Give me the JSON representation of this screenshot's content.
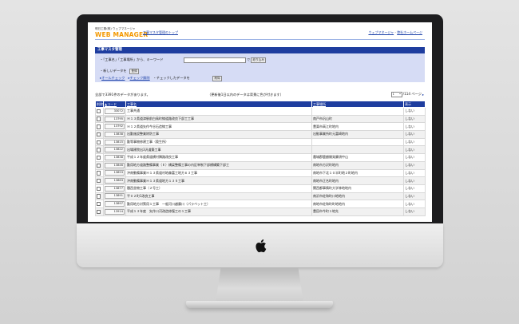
{
  "header": {
    "logo_small": "明日工務(株) ウェブマネージャ",
    "logo_main": "WEB MANAGER",
    "top_link": "工事マスタ管理のトップ",
    "right_links": [
      "ウェブマネージャ",
      "弊社ホームページ"
    ],
    "separator": " - "
  },
  "section": {
    "title": "工事マスタ管理"
  },
  "search": {
    "prefix": "・「工事名」「工事場所」から、キーワード",
    "keyword_value": "",
    "suffix": "で",
    "filter_button": "絞り込み"
  },
  "actions": {
    "new_prefix": "・新しいデータを",
    "new_button": "登録",
    "check_all": "オールチェック",
    "uncheck_all": "チェック解除",
    "checked_prefix": "・チェックしたデータを",
    "delete_button": "削除"
  },
  "summary": "全部で3391件のデータがあります。",
  "note": "（更新後1日以内のデータは背景に色が付きます）",
  "pager": {
    "current_page": "1",
    "total": "/114 ページ",
    "next": "▸"
  },
  "table": {
    "headers": {
      "delete": "削除",
      "code": "▲コード",
      "name": "工事名",
      "place": "工事場所",
      "display": "表示"
    },
    "rows": [
      {
        "code": "33072",
        "name": "工事共通",
        "place": "",
        "display": "しない"
      },
      {
        "code": "13795",
        "name": "Ｈ１３県道津駅前白鳥町線道路改良下部工工事",
        "place": "南戸市汎山町",
        "display": "しない"
      },
      {
        "code": "13792",
        "name": "Ｈ１２県道矢作今谷石造線工事",
        "place": "豊栗市高江町地内",
        "display": "しない"
      },
      {
        "code": "13838",
        "name": "出勤施設整業除防工事",
        "place": "出勧事業所町元富崎地内",
        "display": "しない"
      },
      {
        "code": "13815",
        "name": "勤等事物修建工事（奥生所）",
        "place": "",
        "display": "しない"
      },
      {
        "code": "13822",
        "name": "出場建院出3汎道築工事",
        "place": "",
        "display": "しない"
      },
      {
        "code": "13838",
        "name": "平成１２年度県道横村隣路改良工事",
        "place": "農城郡鹿額開発廉頃中山",
        "display": "しない"
      },
      {
        "code": "13846",
        "name": "勤用地方道路整備事業（Ｅ）橋梁整備工事の内区単制下部横構築下部工",
        "place": "南地市方沢町地内",
        "display": "しない"
      },
      {
        "code": "13853",
        "name": "沖南動備事業Ｈ１３県道村地森富工地方６３工事",
        "place": "南地市下北１０半町地２町地内",
        "display": "しない"
      },
      {
        "code": "13863",
        "name": "沖南動備事業Ｈ１３県道地方１３５工事",
        "place": "南地市正名町地内",
        "display": "しない"
      },
      {
        "code": "13877",
        "name": "題西並物工事（２号工）",
        "place": "関西都事情町大学林地地内",
        "display": "しない"
      },
      {
        "code": "13891",
        "name": "平０２町1改良工事",
        "place": "南沢市佐和町川地地内",
        "display": "しない"
      },
      {
        "code": "13897",
        "name": "勤用地方対策用１工事　一般河川越廣川（パラペット工）",
        "place": "南地市佐和町町地地内",
        "display": "しない"
      },
      {
        "code": "13914",
        "name": "平成１３年度　矢作川河改造修復工の１工事",
        "place": "豊田市今町１地先",
        "display": "しない"
      }
    ]
  }
}
